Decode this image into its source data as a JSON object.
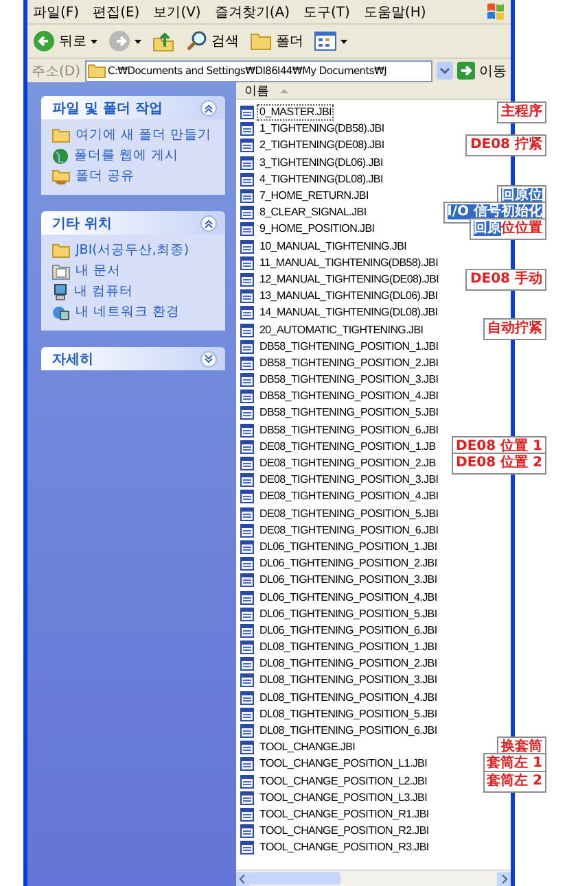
{
  "menu": [
    "파일(F)",
    "편집(E)",
    "보기(V)",
    "즐겨찾기(A)",
    "도구(T)",
    "도움말(H)"
  ],
  "toolbar": [
    {
      "kind": "back",
      "label": "뒤로"
    },
    {
      "kind": "forward"
    },
    {
      "kind": "up"
    },
    {
      "kind": "search",
      "label": "검색"
    },
    {
      "kind": "folders",
      "label": "폴더"
    },
    {
      "kind": "views"
    }
  ],
  "address": {
    "label": "주소(D)",
    "value": "C:₩Documents and Settings₩DI86I44₩My Documents₩J",
    "go": "이동"
  },
  "panels": [
    {
      "title": "파일 및 폴더 작업",
      "expanded": true,
      "items": [
        {
          "label": "여기에 새 폴더 만들기"
        },
        {
          "label": "폴더를 웹에 게시"
        },
        {
          "label": "폴더 공유"
        }
      ]
    },
    {
      "title": "기타 위치",
      "expanded": true,
      "items": [
        {
          "label": "JBI(서공두산,최종)"
        },
        {
          "label": "내 문서"
        },
        {
          "label": "내 컴퓨터"
        },
        {
          "label": "내 네트워크 환경"
        }
      ]
    },
    {
      "title": "자세히",
      "expanded": false
    }
  ],
  "list": {
    "column": "이름",
    "files": [
      {
        "name": "0_MASTER.JBI",
        "selected": true,
        "note": [
          {
            "text": "主程序",
            "highlight": false
          }
        ]
      },
      {
        "name": "1_TIGHTENING(DB58).JBI",
        "selected": false
      },
      {
        "name": "2_TIGHTENING(DE08).JBI",
        "selected": false,
        "note": [
          {
            "text": "DE08 拧紧",
            "highlight": false
          }
        ]
      },
      {
        "name": "3_TIGHTENING(DL06).JBI",
        "selected": false
      },
      {
        "name": "4_TIGHTENING(DL08).JBI",
        "selected": false
      },
      {
        "name": "7_HOME_RETURN.JBI",
        "selected": false,
        "note": [
          {
            "text": "回原位",
            "highlight": true
          }
        ]
      },
      {
        "name": "8_CLEAR_SIGNAL.JBI",
        "selected": false,
        "note": [
          {
            "text": "I/O 信号初始化",
            "highlight": true
          }
        ]
      },
      {
        "name": "9_HOME_POSITION.JBI",
        "selected": false,
        "note": [
          {
            "text": "回原",
            "highlight": true
          },
          {
            "text": "位位置",
            "highlight": false
          }
        ]
      },
      {
        "name": "10_MANUAL_TIGHTENING.JBI",
        "selected": false
      },
      {
        "name": "11_MANUAL_TIGHTENING(DB58).JBI",
        "selected": false
      },
      {
        "name": "12_MANUAL_TIGHTENING(DE08).JBI",
        "selected": false,
        "note": [
          {
            "text": "DE08 手动",
            "highlight": false
          }
        ]
      },
      {
        "name": "13_MANUAL_TIGHTENING(DL06).JBI",
        "selected": false
      },
      {
        "name": "14_MANUAL_TIGHTENING(DL08).JBI",
        "selected": false
      },
      {
        "name": "20_AUTOMATIC_TIGHTENING.JBI",
        "selected": false,
        "note": [
          {
            "text": "自动拧紧",
            "highlight": false
          }
        ]
      },
      {
        "name": "DB58_TIGHTENING_POSITION_1.JBI",
        "selected": false
      },
      {
        "name": "DB58_TIGHTENING_POSITION_2.JBI",
        "selected": false
      },
      {
        "name": "DB58_TIGHTENING_POSITION_3.JBI",
        "selected": false
      },
      {
        "name": "DB58_TIGHTENING_POSITION_4.JBI",
        "selected": false
      },
      {
        "name": "DB58_TIGHTENING_POSITION_5.JBI",
        "selected": false
      },
      {
        "name": "DB58_TIGHTENING_POSITION_6.JBI",
        "selected": false
      },
      {
        "name": "DE08_TIGHTENING_POSITION_1.JB",
        "selected": false,
        "note": [
          {
            "text": "DE08  位置 1",
            "highlight": false
          }
        ]
      },
      {
        "name": "DE08_TIGHTENING_POSITION_2.JB",
        "selected": false,
        "note": [
          {
            "text": "DE08  位置 2",
            "highlight": false
          }
        ]
      },
      {
        "name": "DE08_TIGHTENING_POSITION_3.JBI",
        "selected": false
      },
      {
        "name": "DE08_TIGHTENING_POSITION_4.JBI",
        "selected": false
      },
      {
        "name": "DE08_TIGHTENING_POSITION_5.JBI",
        "selected": false
      },
      {
        "name": "DE08_TIGHTENING_POSITION_6.JBI",
        "selected": false
      },
      {
        "name": "DL06_TIGHTENING_POSITION_1.JBI",
        "selected": false
      },
      {
        "name": "DL06_TIGHTENING_POSITION_2.JBI",
        "selected": false
      },
      {
        "name": "DL06_TIGHTENING_POSITION_3.JBI",
        "selected": false
      },
      {
        "name": "DL06_TIGHTENING_POSITION_4.JBI",
        "selected": false
      },
      {
        "name": "DL06_TIGHTENING_POSITION_5.JBI",
        "selected": false
      },
      {
        "name": "DL06_TIGHTENING_POSITION_6.JBI",
        "selected": false
      },
      {
        "name": "DL08_TIGHTENING_POSITION_1.JBI",
        "selected": false
      },
      {
        "name": "DL08_TIGHTENING_POSITION_2.JBI",
        "selected": false
      },
      {
        "name": "DL08_TIGHTENING_POSITION_3.JBI",
        "selected": false
      },
      {
        "name": "DL08_TIGHTENING_POSITION_4.JBI",
        "selected": false
      },
      {
        "name": "DL08_TIGHTENING_POSITION_5.JBI",
        "selected": false
      },
      {
        "name": "DL08_TIGHTENING_POSITION_6.JBI",
        "selected": false
      },
      {
        "name": "TOOL_CHANGE.JBI",
        "selected": false,
        "note": [
          {
            "text": "换套筒",
            "highlight": false
          }
        ]
      },
      {
        "name": "TOOL_CHANGE_POSITION_L1.JBI",
        "selected": false,
        "note": [
          {
            "text": "套筒左 1",
            "highlight": false
          }
        ]
      },
      {
        "name": "TOOL_CHANGE_POSITION_L2.JBI",
        "selected": false,
        "note": [
          {
            "text": "套筒左 2",
            "highlight": false
          }
        ]
      },
      {
        "name": "TOOL_CHANGE_POSITION_L3.JBI",
        "selected": false
      },
      {
        "name": "TOOL_CHANGE_POSITION_R1.JBI",
        "selected": false
      },
      {
        "name": "TOOL_CHANGE_POSITION_R2.JBI",
        "selected": false
      },
      {
        "name": "TOOL_CHANGE_POSITION_R3.JBI",
        "selected": false
      }
    ]
  }
}
